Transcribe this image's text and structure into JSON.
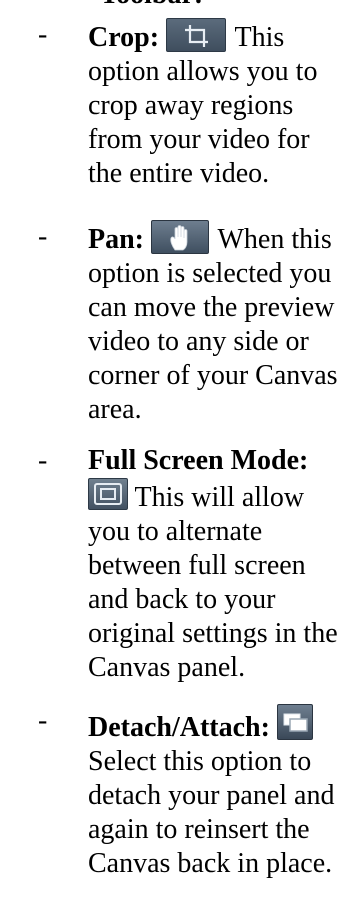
{
  "top_fragment": "Toolbar:",
  "items": [
    {
      "dash": "-",
      "term": "Crop:",
      "icon": "crop-icon",
      "description": "This option allows you to crop away regions from your video for the entire video."
    },
    {
      "dash": "-",
      "term": "Pan:",
      "icon": "hand-icon",
      "description": "When this option is selected you can move the preview video to any side or corner of your Canvas area."
    },
    {
      "dash": "-",
      "term": "Full Screen Mode:",
      "icon": "full-screen-icon",
      "description": "This will allow you to alternate between full screen and back to your original settings in the Canvas panel."
    },
    {
      "dash": "-",
      "term": "Detach/Attach:",
      "icon": "detach-attach-icon",
      "description": "Select this option to detach your panel and again to reinsert the Canvas back in place."
    }
  ]
}
